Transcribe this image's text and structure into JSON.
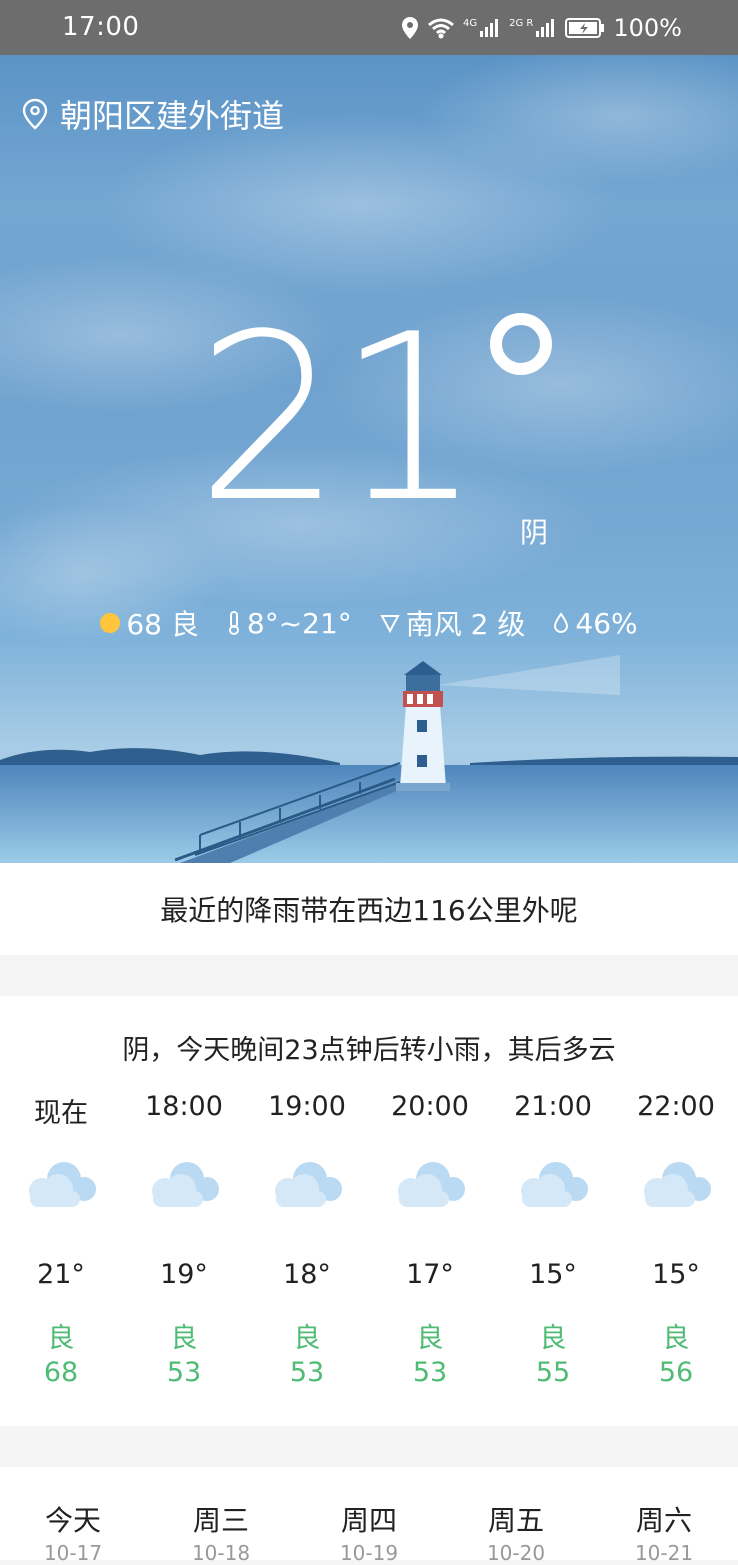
{
  "status_bar": {
    "time": "17:00",
    "battery": "100%",
    "network_a": "4G",
    "network_b": "2G R"
  },
  "location": {
    "name": "朝阳区建外街道",
    "icon": "location-pin-icon"
  },
  "current": {
    "temperature": "21",
    "condition": "阴",
    "aqi": "68 良",
    "temp_range": "8°~21°",
    "wind": "南风 2 级",
    "humidity": "46%"
  },
  "rain_notice": "最近的降雨带在西边116公里外呢",
  "hourly": {
    "summary": "阴，今天晚间23点钟后转小雨，其后多云",
    "items": [
      {
        "time": "现在",
        "icon": "cloudy-icon",
        "temp": "21°",
        "aqi_label": "良",
        "aqi_value": "68"
      },
      {
        "time": "18:00",
        "icon": "cloudy-icon",
        "temp": "19°",
        "aqi_label": "良",
        "aqi_value": "53"
      },
      {
        "time": "19:00",
        "icon": "cloudy-icon",
        "temp": "18°",
        "aqi_label": "良",
        "aqi_value": "53"
      },
      {
        "time": "20:00",
        "icon": "cloudy-icon",
        "temp": "17°",
        "aqi_label": "良",
        "aqi_value": "53"
      },
      {
        "time": "21:00",
        "icon": "cloudy-icon",
        "temp": "15°",
        "aqi_label": "良",
        "aqi_value": "55"
      },
      {
        "time": "22:00",
        "icon": "cloudy-icon",
        "temp": "15°",
        "aqi_label": "良",
        "aqi_value": "56"
      }
    ]
  },
  "daily": {
    "items": [
      {
        "day": "今天",
        "date": "10-17"
      },
      {
        "day": "周三",
        "date": "10-18"
      },
      {
        "day": "周四",
        "date": "10-19"
      },
      {
        "day": "周五",
        "date": "10-20"
      },
      {
        "day": "周六",
        "date": "10-21"
      }
    ]
  },
  "colors": {
    "status_bar": "#6d6d6d",
    "sky_top": "#5b94c6",
    "aqi_good": "#4fbb74",
    "cloud": "#b8d8f0"
  }
}
